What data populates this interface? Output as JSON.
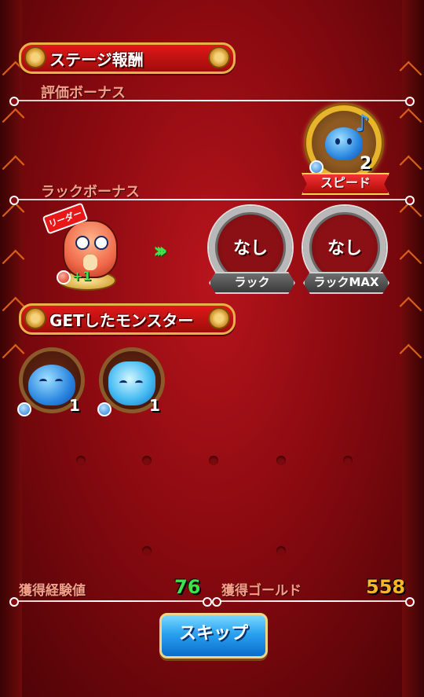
{
  "stage_reward": {
    "banner_label": "ステージ報酬"
  },
  "rating_bonus": {
    "section_label": "評価ボーナス",
    "medal": {
      "label": "スピード",
      "count": "2",
      "icon": "blue-slime-note-icon"
    }
  },
  "luck_bonus": {
    "section_label": "ラックボーナス",
    "leader": {
      "tag": "リーダー",
      "plus_label": "+1",
      "icon": "red-dragon-monster-icon"
    },
    "arrow_icon": "green-chevrons-icon",
    "slots": [
      {
        "value": "なし",
        "plate": "ラック"
      },
      {
        "value": "なし",
        "plate": "ラックMAX"
      }
    ]
  },
  "obtained": {
    "banner_label": "GETしたモンスター",
    "monsters": [
      {
        "name_icon": "blue-slime-icon",
        "count": "1"
      },
      {
        "name_icon": "blue-flame-slime-icon",
        "count": "1"
      }
    ]
  },
  "totals": {
    "exp_label": "獲得経験値",
    "exp_value": "76",
    "gold_label": "獲得ゴールド",
    "gold_value": "558"
  },
  "skip_label": "スキップ",
  "colors": {
    "exp_value": "#3fe24a",
    "gold_value": "#f7b52a",
    "accent_red": "#d8141c",
    "skip_blue": "#2aa2f0"
  }
}
